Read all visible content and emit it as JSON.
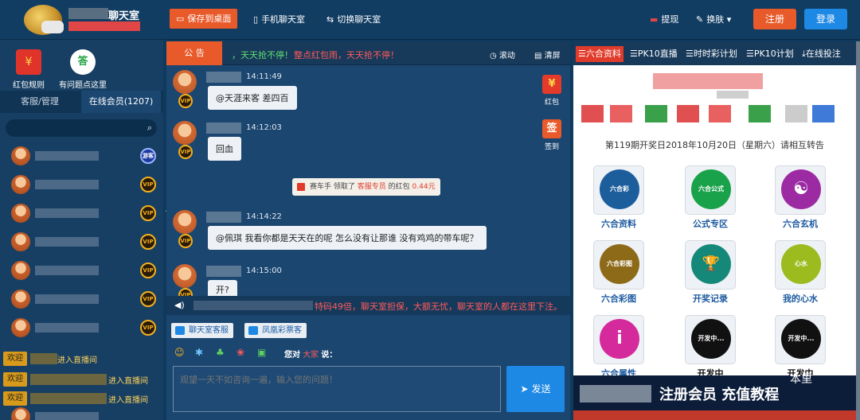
{
  "header": {
    "app_title": "聊天室",
    "save_desktop": "保存到桌面",
    "mobile_chat": "手机聊天室",
    "switch_chat": "切换聊天室",
    "withdraw": "提现",
    "skin": "换肤",
    "register": "注册",
    "login": "登录"
  },
  "left": {
    "red_rules": "红包规则",
    "faq": "有问题点这里",
    "tab_service": "客服/管理",
    "tab_online": "在线会员(1207)",
    "search_placeholder": "",
    "badges": {
      "guest": "游客",
      "vip": "VIP"
    },
    "welcome_tag": "欢迎",
    "welcome_text": "进入直播间"
  },
  "notice": {
    "tag": "公 告",
    "text": "，天天抢不停！",
    "text2": "整点红包雨，天天抢不停！",
    "scroll": "滚动",
    "clear": "清屏"
  },
  "messages": [
    {
      "time": "14:11:49",
      "text": "@天涯来客 差四百",
      "badge": "VIP"
    },
    {
      "time": "14:12:03",
      "text": "回血",
      "badge": "VIP"
    },
    {
      "time": "14:14:22",
      "text": "@佩琪 我看你都是天天在的呢 怎么没有让那谁 没有鸡鸡的带车呢？",
      "badge": "VIP"
    },
    {
      "time": "14:15:00",
      "text": "开?",
      "badge": "VIP"
    }
  ],
  "redpacket": {
    "prefix": "赛车手 领取了",
    "who": "客服专员",
    "mid": "的红包",
    "amount": "0.44元"
  },
  "side": {
    "redpacket": "红包",
    "signin": "签到",
    "signin_glyph": "签"
  },
  "marquee": "特码49倍，聊天室担保，大额无忧，聊天室的人都在这里下注。",
  "service_buttons": [
    "聊天室客服",
    "凤凰彩票客"
  ],
  "compose": {
    "to_prefix": "您对",
    "to_target": "大家",
    "to_suffix": "说：",
    "placeholder": "观望一天不如咨询一遍，输入您的问题！",
    "send": "发送"
  },
  "right": {
    "tabs": [
      "六合资料",
      "PK10直播",
      "时时彩计划",
      "PK10计划",
      "在线投注"
    ],
    "draw_info": "第119期开奖日2018年10月20日（星期六）请相互转告",
    "grid": [
      {
        "label": "六合资料",
        "inner": "六合彩",
        "color": "#1c5d9c"
      },
      {
        "label": "公式专区",
        "inner": "六合公式",
        "color": "#1aa24a"
      },
      {
        "label": "六合玄机",
        "inner": "☯",
        "color": "#9c2ba3"
      },
      {
        "label": "六合彩图",
        "inner": "六合彩图",
        "color": "#8c6a18"
      },
      {
        "label": "开奖记录",
        "inner": "🏆",
        "color": "#15887a"
      },
      {
        "label": "我的心水",
        "inner": "心水",
        "color": "#9bbb1e"
      },
      {
        "label": "六合属性",
        "inner": "i",
        "color": "#d42a9c"
      },
      {
        "label": "开发中",
        "inner": "开发中...",
        "color": "#111111"
      },
      {
        "label": "开发中",
        "inner": "开发中...",
        "color": "#111111"
      }
    ],
    "banner": "注册会员 充值教程",
    "watermark": "本里"
  },
  "colors": {
    "accent": "#e85a2a",
    "primary": "#1e88e5",
    "dark_bg": "#0e3a5e"
  }
}
